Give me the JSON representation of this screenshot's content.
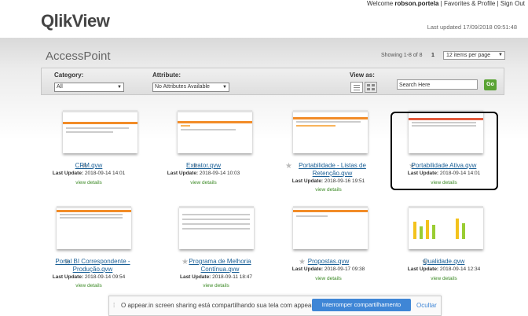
{
  "header": {
    "welcome_prefix": "Welcome ",
    "user": "robson.portela",
    "links": [
      "Favorites & Profile",
      "Sign Out"
    ],
    "logo_text": "QlikView",
    "last_updated": "Last updated 17/09/2018 09:51:48"
  },
  "page": {
    "title": "AccessPoint",
    "showing": "Showing 1-8 of 8",
    "page_number": "1",
    "per_page": "12 items per page"
  },
  "filters": {
    "category_label": "Category:",
    "category_value": "All",
    "attribute_label": "Attribute:",
    "attribute_value": "No Attributes Available",
    "view_as_label": "View as:",
    "search_placeholder": "Search Here",
    "go_label": "Go"
  },
  "documents": [
    {
      "name": "CRM.qvw",
      "update_label": "Last Update:",
      "update": "2018-09-14 14:01",
      "details": "view details"
    },
    {
      "name": "Extrator.qvw",
      "update_label": "Last Update:",
      "update": "2018-09-14 10:03",
      "details": "view details"
    },
    {
      "name": "Portabilidade - Listas de Retenção.qvw",
      "update_label": "Last Update:",
      "update": "2018-09-16 19:51",
      "details": "view details"
    },
    {
      "name": "Portabilidade Ativa.qvw",
      "update_label": "Last Update:",
      "update": "2018-09-14 14:01",
      "details": "view details"
    },
    {
      "name": "Portal BI Correspondente - Produção.qvw",
      "update_label": "Last Update:",
      "update": "2018-09-14 09:54",
      "details": "view details"
    },
    {
      "name": "Programa de Melhoria Contínua.qvw",
      "update_label": "Last Update:",
      "update": "2018-09-11 18:47",
      "details": "view details"
    },
    {
      "name": "Propostas.qvw",
      "update_label": "Last Update:",
      "update": "2018-09-17 09:38",
      "details": "view details"
    },
    {
      "name": "Qualidade.qvw",
      "update_label": "Last Update:",
      "update": "2018-09-14 12:34",
      "details": "view details"
    }
  ],
  "share_bar": {
    "message": "O appear.in screen sharing está compartilhando sua tela com appear.in.",
    "stop_label": "Interromper compartilhamento",
    "hide_label": "Ocultar"
  },
  "colors": {
    "brand_green": "#4d9e2a",
    "link_blue": "#1a5f96",
    "accent_orange": "#f28c28"
  }
}
